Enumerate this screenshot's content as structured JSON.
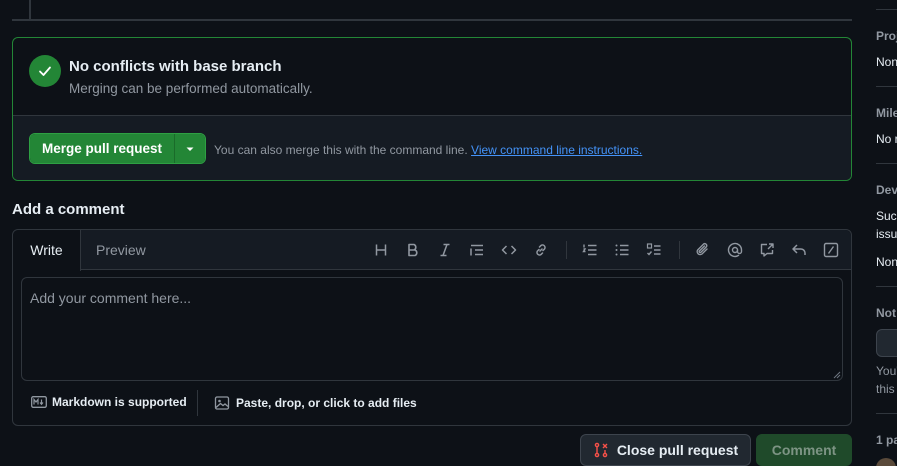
{
  "merge": {
    "title": "No conflicts with base branch",
    "subtitle": "Merging can be performed automatically.",
    "merge_button": "Merge pull request",
    "hint_text": "You can also merge this with the command line.",
    "hint_link": "View command line instructions."
  },
  "comment": {
    "heading": "Add a comment",
    "tab_write": "Write",
    "tab_preview": "Preview",
    "placeholder": "Add your comment here...",
    "markdown_note": "Markdown is supported",
    "attach_note": "Paste, drop, or click to add files",
    "toolbar_icons": [
      "heading-icon",
      "bold-icon",
      "italic-icon",
      "quote-icon",
      "code-icon",
      "link-icon",
      "numbered-list-icon",
      "unordered-list-icon",
      "task-list-icon",
      "attach-icon",
      "mention-icon",
      "cross-reference-icon",
      "reply-icon",
      "slash-command-icon"
    ]
  },
  "actions": {
    "close_pr": "Close pull request",
    "comment": "Comment"
  },
  "sidebar": {
    "projects_label": "Proj",
    "projects_value": "Non",
    "milestone_label": "Mile",
    "milestone_value": "No r",
    "development_label": "Dev",
    "development_text1": "Succ",
    "development_text2": "issu",
    "development_value": "Non",
    "notifications_label": "Not",
    "notifications_text1": "You'",
    "notifications_text2": "this",
    "participants_label": "1 pa"
  },
  "colors": {
    "accent_green": "#238636",
    "link_blue": "#4493f8",
    "danger_red": "#f85149"
  }
}
